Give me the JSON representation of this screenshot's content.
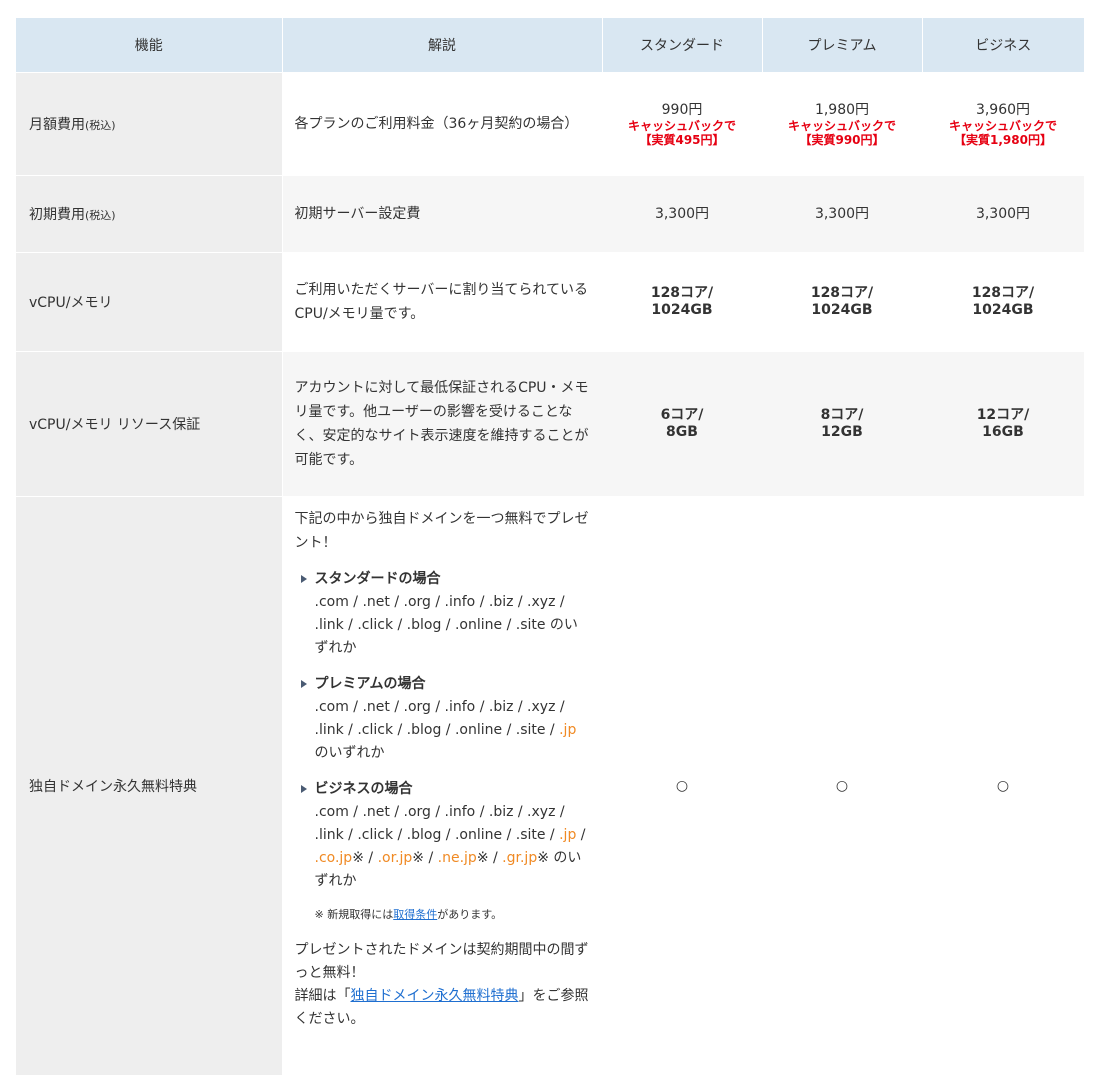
{
  "headers": [
    "機能",
    "解説",
    "スタンダード",
    "プレミアム",
    "ビジネス"
  ],
  "rows": {
    "monthly_fee": {
      "label": "月額費用",
      "label_small": "(税込)",
      "desc": "各プランのご利用料金（36ヶ月契約の場合）",
      "values": [
        {
          "price": "990円",
          "cashback": "キャッシュバックで",
          "real": "【実質495円】"
        },
        {
          "price": "1,980円",
          "cashback": "キャッシュバックで",
          "real": "【実質990円】"
        },
        {
          "price": "3,960円",
          "cashback": "キャッシュバックで",
          "real": "【実質1,980円】"
        }
      ]
    },
    "initial_fee": {
      "label": "初期費用",
      "label_small": "(税込)",
      "desc": "初期サーバー設定費",
      "values": [
        "3,300円",
        "3,300円",
        "3,300円"
      ]
    },
    "vcpu": {
      "label": "vCPU/メモリ",
      "desc": "ご利用いただくサーバーに割り当てられているCPU/メモリ量です。",
      "values": [
        {
          "line1": "128コア/",
          "line2": "1024GB"
        },
        {
          "line1": "128コア/",
          "line2": "1024GB"
        },
        {
          "line1": "128コア/",
          "line2": "1024GB"
        }
      ]
    },
    "resource": {
      "label": "vCPU/メモリ リソース保証",
      "desc": "アカウントに対して最低保証されるCPU・メモリ量です。他ユーザーの影響を受けることなく、安定的なサイト表示速度を維持することが可能です。",
      "values": [
        {
          "line1": "6コア/",
          "line2": "8GB"
        },
        {
          "line1": "8コア/",
          "line2": "12GB"
        },
        {
          "line1": "12コア/",
          "line2": "16GB"
        }
      ]
    },
    "domain": {
      "label": "独自ドメイン永久無料特典",
      "intro": "下記の中から独自ドメインを一つ無料でプレゼント！",
      "standard": {
        "title": "スタンダードの場合",
        "body": ".com / .net / .org / .info / .biz / .xyz / .link / .click / .blog / .online / .site のいずれか"
      },
      "premium": {
        "title": "プレミアムの場合",
        "body_prefix": ".com / .net / .org / .info / .biz / .xyz / .link / .click / .blog / .online / .site / ",
        "jp": ".jp",
        "body_suffix": " のいずれか"
      },
      "business": {
        "title": "ビジネスの場合",
        "body_prefix": ".com / .net / .org / .info / .biz / .xyz / .link / .click / .blog / .online / .site / ",
        "jp": ".jp",
        "sep1": " / ",
        "cojp": ".co.jp",
        "mark1": "※ / ",
        "orjp": ".or.jp",
        "mark2": "※ / ",
        "nejp": ".ne.jp",
        "mark3": "※ / ",
        "grjp": ".gr.jp",
        "mark4": "※ のいずれか"
      },
      "note_prefix": "※ 新規取得には",
      "note_link": "取得条件",
      "note_suffix": "があります。",
      "gift": "プレゼントされたドメインは契約期間中の間ずっと無料！",
      "detail_prefix": "詳細は「",
      "detail_link": "独自ドメイン永久無料特典",
      "detail_suffix": "」をご参照ください。",
      "values": [
        "○",
        "○",
        "○"
      ]
    }
  },
  "colors": {
    "header_bg": "#d9e7f2",
    "feature_bg": "#eeeeee",
    "cashback_red": "#e60012",
    "domain_orange": "#f08a24",
    "link_blue": "#1f6fd0"
  }
}
